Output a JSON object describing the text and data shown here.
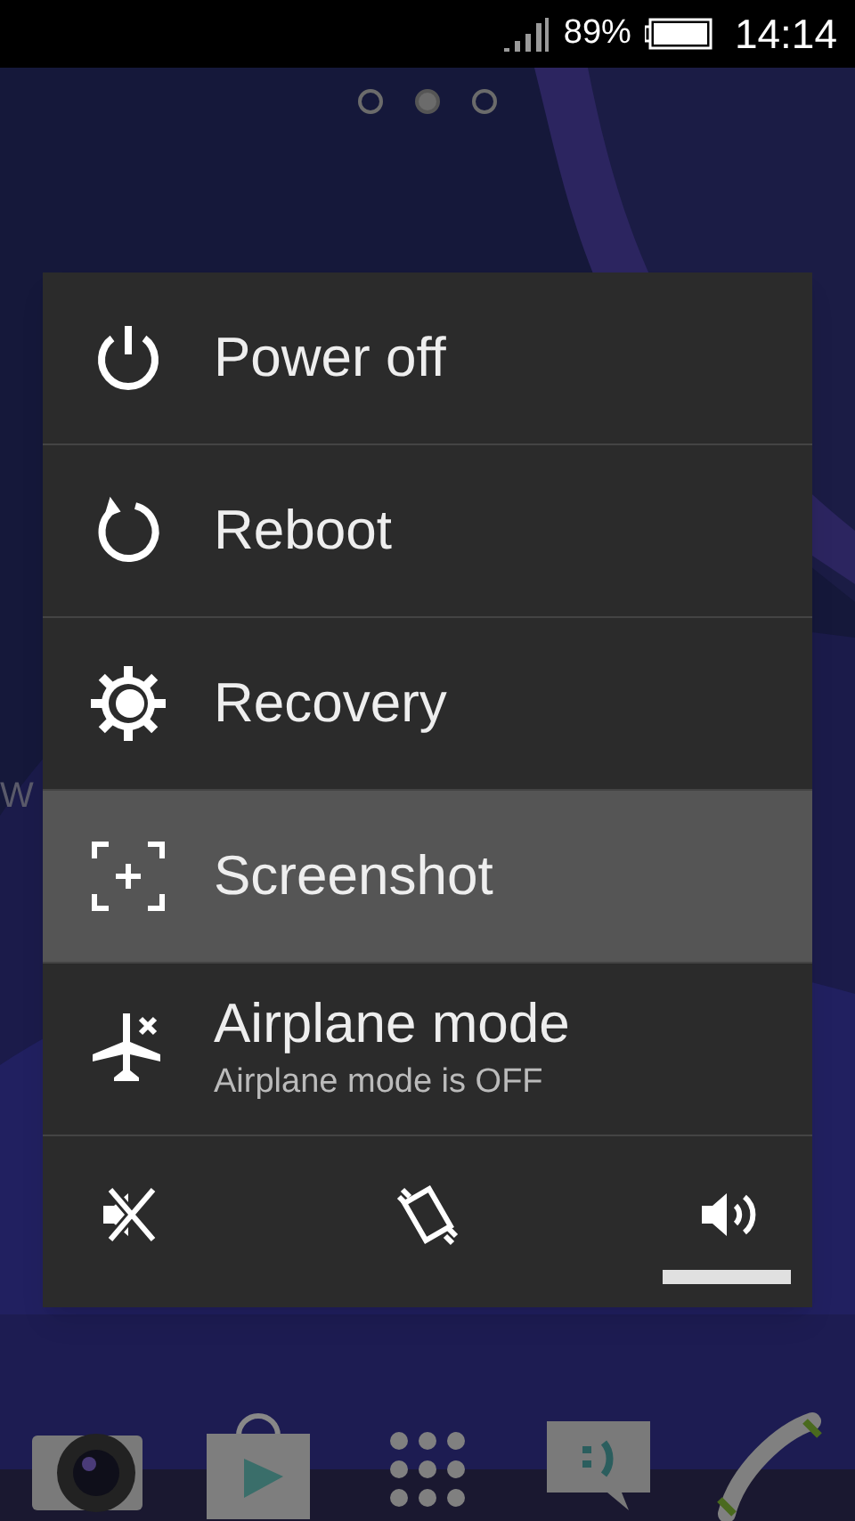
{
  "status_bar": {
    "battery_percent": "89%",
    "time": "14:14"
  },
  "page_indicator": [
    {
      "selected": false
    },
    {
      "selected": true
    },
    {
      "selected": false
    }
  ],
  "background_text": "W",
  "power_menu": {
    "items": [
      {
        "kind": "power",
        "label": "Power off",
        "selected": false
      },
      {
        "kind": "reboot",
        "label": "Reboot",
        "selected": false
      },
      {
        "kind": "recovery",
        "label": "Recovery",
        "selected": false
      },
      {
        "kind": "screenshot",
        "label": "Screenshot",
        "selected": true
      },
      {
        "kind": "airplane",
        "label": "Airplane mode",
        "subtitle": "Airplane mode is OFF",
        "selected": false
      }
    ],
    "sound_modes": [
      {
        "kind": "silent",
        "selected": false
      },
      {
        "kind": "vibrate",
        "selected": false
      },
      {
        "kind": "sound",
        "selected": true
      }
    ]
  },
  "dock": [
    {
      "kind": "camera"
    },
    {
      "kind": "store"
    },
    {
      "kind": "apps"
    },
    {
      "kind": "messaging"
    },
    {
      "kind": "phone"
    }
  ]
}
